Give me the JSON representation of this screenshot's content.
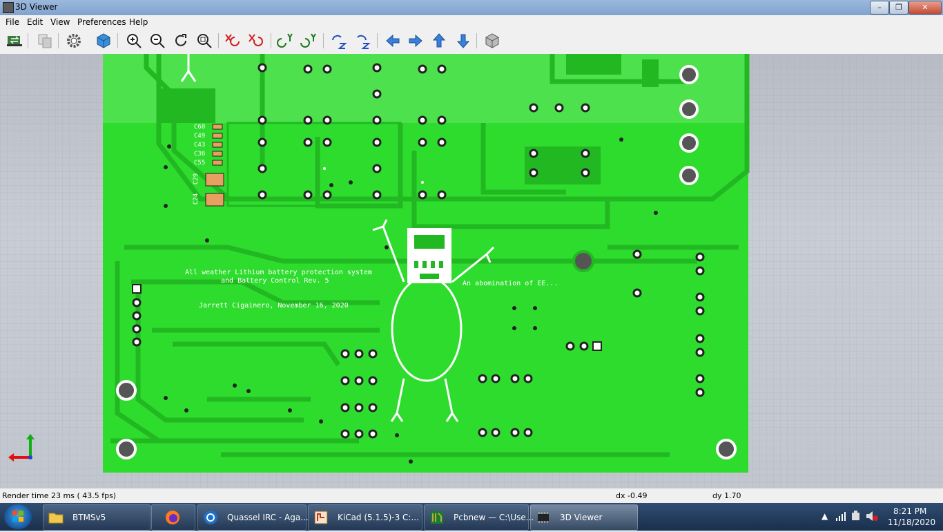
{
  "window": {
    "title": "3D Viewer",
    "controls": [
      "minimize",
      "maximize",
      "close"
    ]
  },
  "menu": {
    "items": [
      "File",
      "Edit",
      "View",
      "Preferences",
      "Help"
    ]
  },
  "toolbar": {
    "buttons": [
      {
        "name": "reload-board-icon"
      },
      {
        "name": "copy-image-icon"
      },
      {
        "name": "settings-icon"
      },
      {
        "name": "render-mode-icon"
      },
      {
        "name": "zoom-in-icon"
      },
      {
        "name": "zoom-out-icon"
      },
      {
        "name": "redraw-icon"
      },
      {
        "name": "zoom-fit-icon"
      },
      {
        "name": "rotate-x-cw-icon"
      },
      {
        "name": "rotate-x-ccw-icon"
      },
      {
        "name": "rotate-y-cw-icon"
      },
      {
        "name": "rotate-y-ccw-icon"
      },
      {
        "name": "rotate-z-cw-icon"
      },
      {
        "name": "rotate-z-ccw-icon"
      },
      {
        "name": "pan-left-icon"
      },
      {
        "name": "pan-right-icon"
      },
      {
        "name": "pan-up-icon"
      },
      {
        "name": "pan-down-icon"
      },
      {
        "name": "orthographic-icon"
      }
    ]
  },
  "board": {
    "silkscreen_line1": "All weather Lithium battery protection system",
    "silkscreen_line2": "and Battery Control Rev. 5",
    "author_line": "Jarrett Cigainero, November 16, 2020",
    "doodle_caption": "An abomination of EE...",
    "cap_labels": [
      "C60",
      "C49",
      "C43",
      "C36",
      "C55"
    ],
    "large_cap_labels": [
      "C29",
      "C24"
    ],
    "pcb_color": "#2edc2e",
    "silk_color": "#ffffff",
    "cap_color": "#e8a060"
  },
  "status": {
    "render_time": "Render time 23 ms ( 43.5 fps)",
    "dx": "dx -0.49",
    "dy": "dy 1.70"
  },
  "taskbar": {
    "tasks": [
      {
        "name": "task-explorer",
        "label": "BTMSv5"
      },
      {
        "name": "task-firefox",
        "label": ""
      },
      {
        "name": "task-quassel",
        "label": "Quassel IRC - Aga..."
      },
      {
        "name": "task-kicad",
        "label": "KiCad (5.1.5)-3 C:..."
      },
      {
        "name": "task-pcbnew",
        "label": "Pcbnew — C:\\Use..."
      },
      {
        "name": "task-3dviewer",
        "label": "3D Viewer"
      }
    ],
    "clock_time": "8:21 PM",
    "clock_date": "11/18/2020"
  }
}
